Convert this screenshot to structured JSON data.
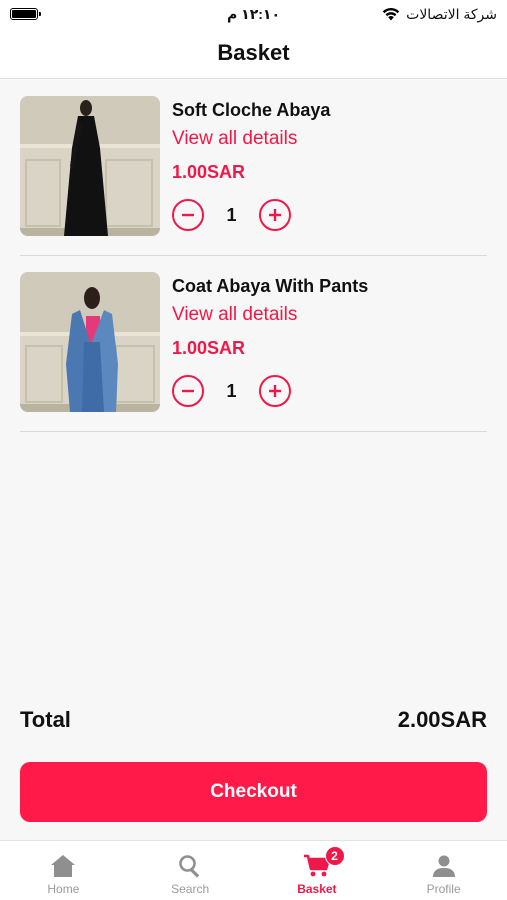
{
  "status_bar": {
    "time": "١٢:١٠ م",
    "carrier": "شركة الاتصالات"
  },
  "header": {
    "title": "Basket"
  },
  "items": [
    {
      "name": "Soft Cloche Abaya",
      "details_link": "View all details",
      "price": "1.00SAR",
      "quantity": "1"
    },
    {
      "name": "Coat Abaya With Pants",
      "details_link": "View all details",
      "price": "1.00SAR",
      "quantity": "1"
    }
  ],
  "summary": {
    "total_label": "Total",
    "total_value": "2.00SAR",
    "checkout_label": "Checkout"
  },
  "tabbar": {
    "tabs": [
      {
        "label": "Home",
        "icon": "home-icon"
      },
      {
        "label": "Search",
        "icon": "search-icon"
      },
      {
        "label": "Basket",
        "icon": "cart-icon",
        "badge": "2"
      },
      {
        "label": "Profile",
        "icon": "profile-icon"
      }
    ],
    "active": "Basket"
  },
  "colors": {
    "accent": "#f0184a",
    "checkout": "#ff1a4a",
    "inactive_tab": "#9a9a9a"
  }
}
